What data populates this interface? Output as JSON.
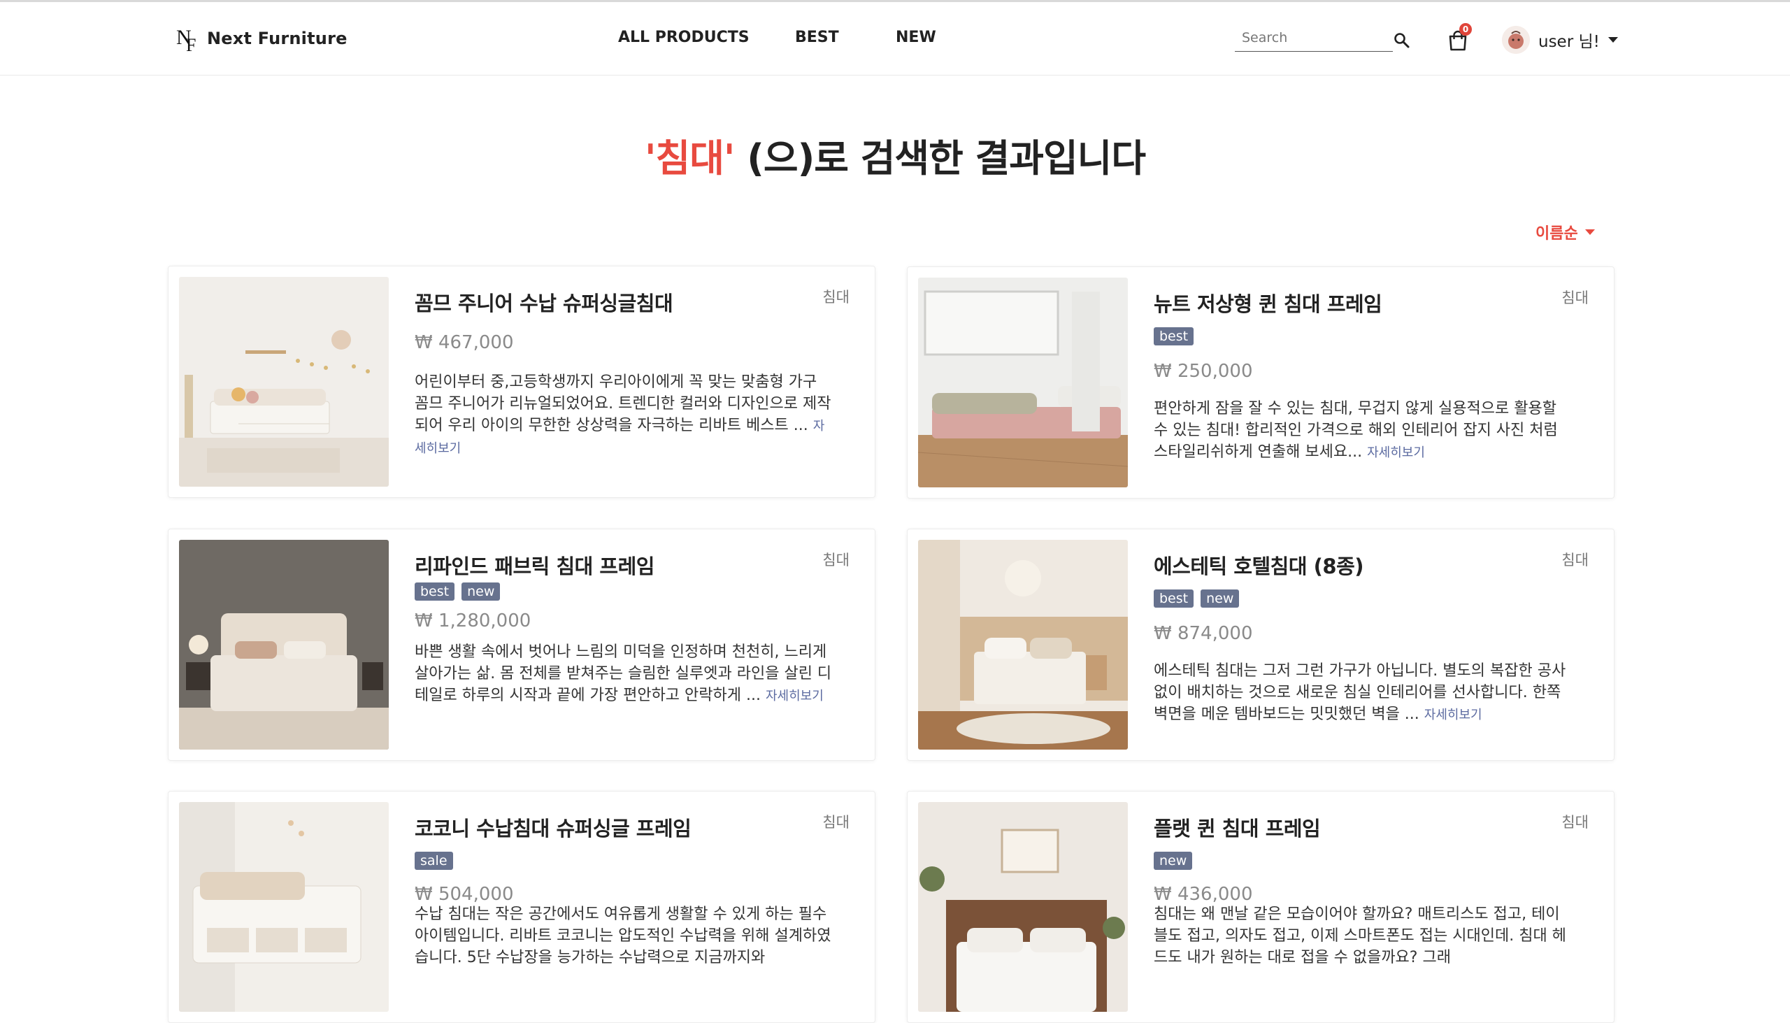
{
  "header": {
    "logo_text": "Next Furniture",
    "nav": [
      "ALL PRODUCTS",
      "BEST",
      "NEW"
    ],
    "search_placeholder": "Search",
    "cart_count": "0",
    "user_label": "user 님!"
  },
  "main": {
    "title_keyword": "'침대'",
    "title_rest": " (으)로 검색한 결과입니다",
    "sort_label": "이름순"
  },
  "products": [
    {
      "name": "꼼므 주니어 수납 슈퍼싱글침대",
      "category": "침대",
      "tags": [],
      "price": "₩ 467,000",
      "desc": "어린이부터 중,고등학생까지 우리아이에게 꼭 맞는 맞춤형 가구 꼼므 주니어가 리뉴얼되었어요. 트렌디한 컬러와 디자인으로 제작되어 우리 아이의 무한한 상상력을 자극하는 리바트 베스트 ...",
      "more": "자세히보기"
    },
    {
      "name": "뉴트 저상형 퀸 침대 프레임",
      "category": "침대",
      "tags": [
        "best"
      ],
      "price": "₩ 250,000",
      "desc": "편안하게 잠을 잘 수 있는 침대, 무겁지 않게 실용적으로 활용할 수 있는 침대! 합리적인 가격으로 해외 인테리어 잡지 사진 처럼 스타일리쉬하게 연출해 보세요...",
      "more": "자세히보기"
    },
    {
      "name": "리파인드 패브릭 침대 프레임",
      "category": "침대",
      "tags": [
        "best",
        "new"
      ],
      "price": "₩ 1,280,000",
      "desc": "바쁜 생활 속에서 벗어나 느림의 미덕을 인정하며 천천히, 느리게 살아가는 삶. 몸 전체를 받쳐주는 슬림한 실루엣과 라인을 살린 디테일로 하루의 시작과 끝에 가장 편안하고 안락하게 ...",
      "more": "자세히보기"
    },
    {
      "name": "에스테틱 호텔침대 (8종)",
      "category": "침대",
      "tags": [
        "best",
        "new"
      ],
      "price": "₩ 874,000",
      "desc": "에스테틱 침대는 그저 그런 가구가 아닙니다. 별도의 복잡한 공사 없이 배치하는 것으로 새로운 침실 인테리어를 선사합니다. 한쪽 벽면을 메운 템바보드는 밋밋했던 벽을 ...",
      "more": "자세히보기"
    },
    {
      "name": "코코니 수납침대 슈퍼싱글 프레임",
      "category": "침대",
      "tags": [
        "sale"
      ],
      "price": "₩ 504,000",
      "desc": "수납 침대는 작은 공간에서도 여유롭게 생활할 수 있게 하는 필수 아이템입니다. 리바트 코코니는 압도적인 수납력을 위해 설계하였습니다. 5단 수납장을 능가하는 수납력으로 지금까지와",
      "more": ""
    },
    {
      "name": "플랫 퀸 침대 프레임",
      "category": "침대",
      "tags": [
        "new"
      ],
      "price": "₩ 436,000",
      "desc": "침대는 왜 맨날 같은 모습이어야 할까요? 매트리스도 접고, 테이블도 접고, 의자도 접고, 이제 스마트폰도 접는 시대인데. 침대 헤드도 내가 원하는 대로 접을 수 없을까요? 그래",
      "more": ""
    }
  ]
}
